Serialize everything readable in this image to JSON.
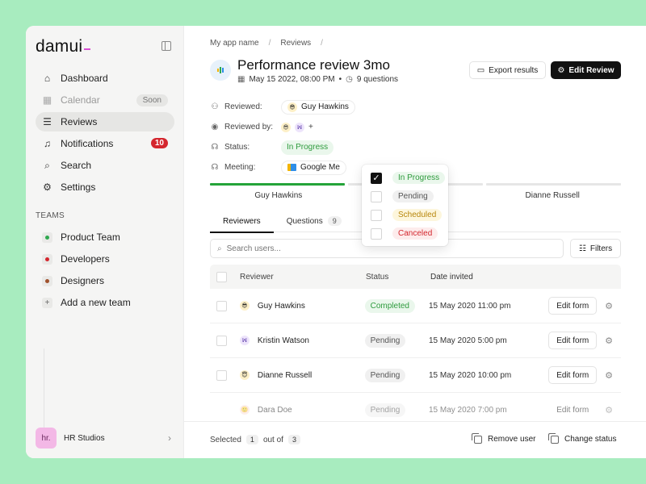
{
  "sidebar": {
    "logo": "damui",
    "nav": [
      {
        "label": "Dashboard",
        "icon": "home-icon",
        "glyph": "⌂"
      },
      {
        "label": "Calendar",
        "icon": "calendar-icon",
        "glyph": "▦",
        "badge": "Soon"
      },
      {
        "label": "Reviews",
        "icon": "reviews-icon",
        "glyph": "☰"
      },
      {
        "label": "Notifications",
        "icon": "bell-icon",
        "glyph": "♫",
        "count": "10"
      },
      {
        "label": "Search",
        "icon": "search-icon",
        "glyph": "⌕"
      },
      {
        "label": "Settings",
        "icon": "gear-icon",
        "glyph": "⚙"
      }
    ],
    "teams_label": "TEAMS",
    "teams": [
      {
        "label": "Product Team",
        "color": "#2fa84f"
      },
      {
        "label": "Developers",
        "color": "#d4262e"
      },
      {
        "label": "Designers",
        "color": "#a0522d"
      },
      {
        "label": "Add a new team",
        "glyph": "+"
      }
    ],
    "workspace": {
      "avatar": "hr.",
      "name": "HR Studios"
    }
  },
  "breadcrumb": [
    "My app name",
    "/",
    "Reviews",
    "/"
  ],
  "header": {
    "title": "Performance review 3mo",
    "date": "May 15 2022, 08:00 PM",
    "dot": "•",
    "questions": "9 questions",
    "export_label": "Export results",
    "edit_label": "Edit Review"
  },
  "props": {
    "reviewed_label": "Reviewed:",
    "reviewed_value": "Guy Hawkins",
    "reviewed_by_label": "Reviewed by:",
    "reviewed_by_plus": "+",
    "status_label": "Status:",
    "status_value": "In Progress",
    "meeting_label": "Meeting:",
    "meeting_value": "Google Me"
  },
  "progress": {
    "labels": [
      "Guy Hawkins",
      "atson",
      "Dianne Russell"
    ],
    "completed_fraction": 0.25
  },
  "tabs": [
    {
      "label": "Reviewers"
    },
    {
      "label": "Questions",
      "count": "9"
    }
  ],
  "search": {
    "placeholder": "Search users...",
    "filters_label": "Filters"
  },
  "table": {
    "headers": {
      "reviewer": "Reviewer",
      "status": "Status",
      "date": "Date invited"
    },
    "rows": [
      {
        "name": "Guy Hawkins",
        "status": "Completed",
        "date": "15 May 2020 11:00 pm",
        "action": "Edit form",
        "avatar_bg": "#fdf0c8",
        "avatar_glyph": "😎"
      },
      {
        "name": "Kristin Watson",
        "status": "Pending",
        "date": "15 May 2020 5:00 pm",
        "action": "Edit form",
        "avatar_bg": "#ede4fb",
        "avatar_glyph": "ꟽ"
      },
      {
        "name": "Dianne Russell",
        "status": "Pending",
        "date": "15 May 2020 10:00 pm",
        "action": "Edit form",
        "avatar_bg": "#fdf0c8",
        "avatar_glyph": "😇"
      },
      {
        "name": "Dara Doe",
        "status": "Pending",
        "date": "15 May 2020 7:00 pm",
        "action": "Edit form",
        "avatar_bg": "#fbe1dc",
        "avatar_glyph": "🙂"
      }
    ]
  },
  "footer": {
    "selected_label": "Selected",
    "selected_count": "1",
    "out_of": "out of",
    "total": "3",
    "remove_label": "Remove user",
    "change_label": "Change status"
  },
  "status_dropdown": {
    "options": [
      {
        "label": "In Progress",
        "checked": true,
        "bg": "#eaf7ec",
        "fg": "#2e9b3d"
      },
      {
        "label": "Pending",
        "checked": false,
        "bg": "#f0f0f0",
        "fg": "#555555"
      },
      {
        "label": "Scheduled",
        "checked": false,
        "bg": "#fdf6dc",
        "fg": "#b7860b"
      },
      {
        "label": "Canceled",
        "checked": false,
        "bg": "#fdecec",
        "fg": "#d4262e"
      }
    ]
  }
}
